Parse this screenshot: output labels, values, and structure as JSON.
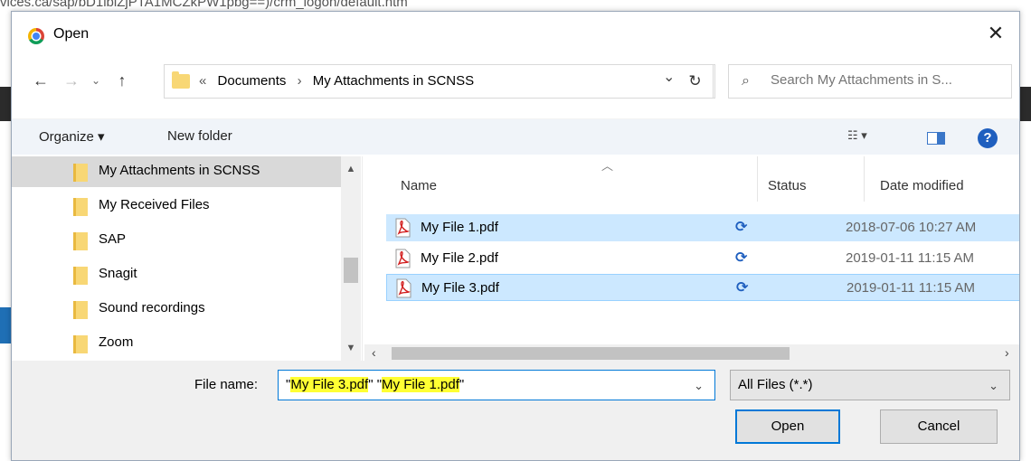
{
  "dialog": {
    "title": "Open",
    "close_glyph": "✕"
  },
  "address": {
    "overflow_glyph": "«",
    "crumbs": [
      "Documents",
      "My Attachments in SCNSS"
    ],
    "separator": "›",
    "dropdown_glyph": "⌄",
    "refresh_glyph": "↻"
  },
  "search": {
    "placeholder": "Search My Attachments in S..."
  },
  "toolbar": {
    "organize_label": "Organize ▾",
    "new_folder_label": "New folder",
    "view_glyph": "☷ ▾",
    "help_glyph": "?"
  },
  "nav_pane": {
    "items": [
      {
        "label": "My Attachments in SCNSS",
        "selected": true
      },
      {
        "label": "My Received Files",
        "selected": false
      },
      {
        "label": "SAP",
        "selected": false
      },
      {
        "label": "Snagit",
        "selected": false
      },
      {
        "label": "Sound recordings",
        "selected": false
      },
      {
        "label": "Zoom",
        "selected": false
      }
    ]
  },
  "file_list": {
    "columns": {
      "name": "Name",
      "status": "Status",
      "date": "Date modified"
    },
    "rows": [
      {
        "name": "My File 1.pdf",
        "status_glyph": "⟳",
        "date": "2018-07-06 10:27 AM",
        "selected": true,
        "focused": false
      },
      {
        "name": "My File 2.pdf",
        "status_glyph": "⟳",
        "date": "2019-01-11 11:15 AM",
        "selected": false,
        "focused": false
      },
      {
        "name": "My File 3.pdf",
        "status_glyph": "⟳",
        "date": "2019-01-11 11:15 AM",
        "selected": true,
        "focused": true
      }
    ]
  },
  "bottom": {
    "file_name_label": "File name:",
    "file_name_parts": [
      {
        "text": "\"",
        "hl": false
      },
      {
        "text": "My File 3.pdf",
        "hl": true
      },
      {
        "text": "\" \"",
        "hl": false
      },
      {
        "text": "My File 1.pdf",
        "hl": true
      },
      {
        "text": "\"",
        "hl": false
      }
    ],
    "file_type": "All Files (*.*)",
    "open_label": "Open",
    "cancel_label": "Cancel"
  },
  "background": {
    "url_text": "vices.ca/sap/bD1lbiZjPTA1MCZkPW1pbg==)/crm_logon/default.htm"
  },
  "colors": {
    "accent": "#0078d7",
    "selection": "#cce8ff",
    "highlight": "#ffff33",
    "folder": "#f8d775"
  }
}
